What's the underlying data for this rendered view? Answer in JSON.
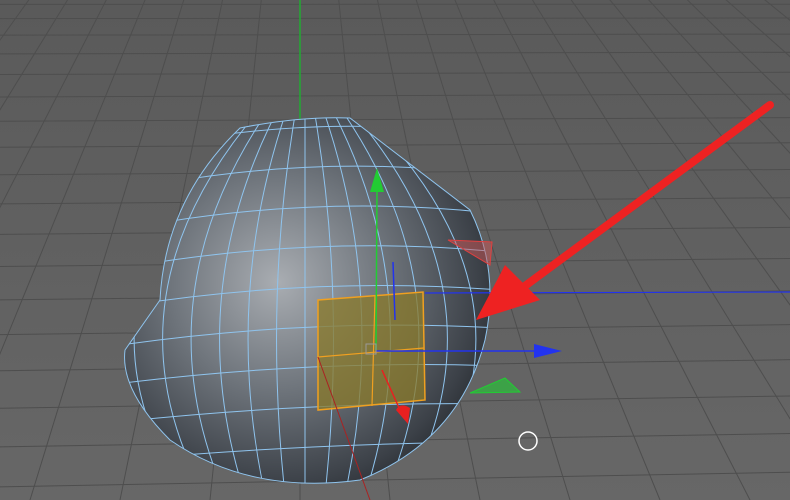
{
  "viewport": {
    "colors": {
      "background": "#5f5f5f",
      "grid": "#4e4e4e",
      "wireframe": "#8fc4ee",
      "selection": "#f0a020",
      "selection_fill": "#8a7a2a",
      "axis_x": "#e82020",
      "axis_y": "#22cc33",
      "axis_z": "#2233ee",
      "annotation_arrow": "#ee2222"
    },
    "icons": [
      "move-gizmo",
      "annotation-arrow",
      "cursor-circle"
    ]
  }
}
